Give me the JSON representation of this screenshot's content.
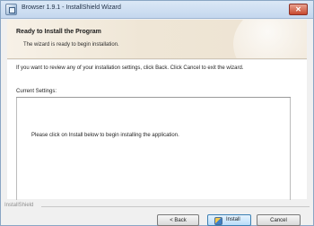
{
  "window": {
    "title": "Browser 1.9.1 - InstallShield Wizard",
    "close_label": "✕"
  },
  "banner": {
    "title": "Ready to Install the Program",
    "subtitle": "The wizard is ready to begin installation."
  },
  "content": {
    "instructions": "If you want to review any of your installation settings, click Back. Click Cancel to exit the wizard.",
    "settings_label": "Current Settings:",
    "settings_text": "Please click on Install below to begin installing the application."
  },
  "footer": {
    "brand": "InstallShield"
  },
  "buttons": {
    "back": "< Back",
    "install": "Install",
    "cancel": "Cancel"
  }
}
